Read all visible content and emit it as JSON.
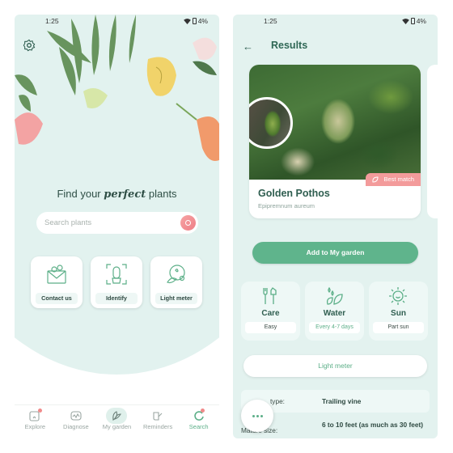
{
  "status_bar": {
    "time": "1:25",
    "battery": "4%"
  },
  "explore_screen": {
    "title_prefix": "Find your ",
    "title_emphasis": "perfect",
    "title_suffix": " plants",
    "search": {
      "placeholder": "Search plants"
    },
    "tiles": [
      {
        "label": "Contact us",
        "icon": "envelope-flower-icon"
      },
      {
        "label": "Identify",
        "icon": "cactus-scan-icon"
      },
      {
        "label": "Light meter",
        "icon": "light-meter-icon"
      }
    ],
    "bottom_nav": [
      {
        "label": "Explore",
        "icon": "explore-icon"
      },
      {
        "label": "Diagnose",
        "icon": "diagnose-icon"
      },
      {
        "label": "My garden",
        "icon": "leaf-icon",
        "active": true
      },
      {
        "label": "Reminders",
        "icon": "watering-can-icon"
      },
      {
        "label": "Search",
        "icon": "search-icon"
      }
    ]
  },
  "results_screen": {
    "title": "Results",
    "result_card": {
      "badge": "Best match",
      "name": "Golden Pothos",
      "scientific_name": "Epipremnum aureum"
    },
    "add_button": "Add to My garden",
    "stats": [
      {
        "title": "Care",
        "value": "Easy",
        "icon": "garden-tools-icon"
      },
      {
        "title": "Water",
        "value": "Every 4-7 days",
        "icon": "water-drops-icon"
      },
      {
        "title": "Sun",
        "value": "Part sun",
        "icon": "sun-icon"
      }
    ],
    "light_meter_button": "Light meter",
    "info": [
      {
        "key": "Plant type:",
        "visible_key": "type:",
        "value": "Trailing vine"
      },
      {
        "key": "Mature size:",
        "value": "6 to 10 feet (as much as 30 feet)"
      }
    ]
  },
  "colors": {
    "accent_green": "#5fb48c",
    "badge_pink": "#f39b9b",
    "bg_mint": "#e2f2ef"
  }
}
